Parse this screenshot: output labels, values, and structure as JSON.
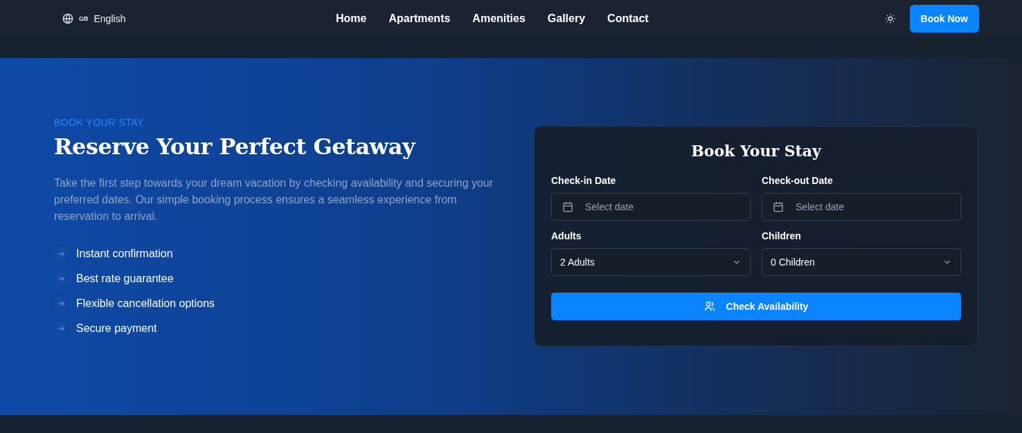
{
  "header": {
    "language": {
      "code": "GB",
      "label": "English"
    },
    "nav": [
      {
        "label": "Home"
      },
      {
        "label": "Apartments"
      },
      {
        "label": "Amenities"
      },
      {
        "label": "Gallery"
      },
      {
        "label": "Contact"
      }
    ],
    "cta": "Book Now"
  },
  "hero": {
    "eyebrow": "BOOK YOUR STAY",
    "title": "Reserve Your Perfect Getaway",
    "description": "Take the first step towards your dream vacation by checking availability and securing your preferred dates. Our simple booking process ensures a seamless experience from reservation to arrival.",
    "features": [
      "Instant confirmation",
      "Best rate guarantee",
      "Flexible cancellation options",
      "Secure payment"
    ]
  },
  "booking": {
    "title": "Book Your Stay",
    "fields": [
      {
        "kind": "date",
        "label": "Check-in Date",
        "placeholder": "Select date"
      },
      {
        "kind": "date",
        "label": "Check-out Date",
        "placeholder": "Select date"
      },
      {
        "kind": "select",
        "label": "Adults",
        "value": "2 Adults"
      },
      {
        "kind": "select",
        "label": "Children",
        "value": "0 Children"
      }
    ],
    "submit": "Check Availability"
  }
}
